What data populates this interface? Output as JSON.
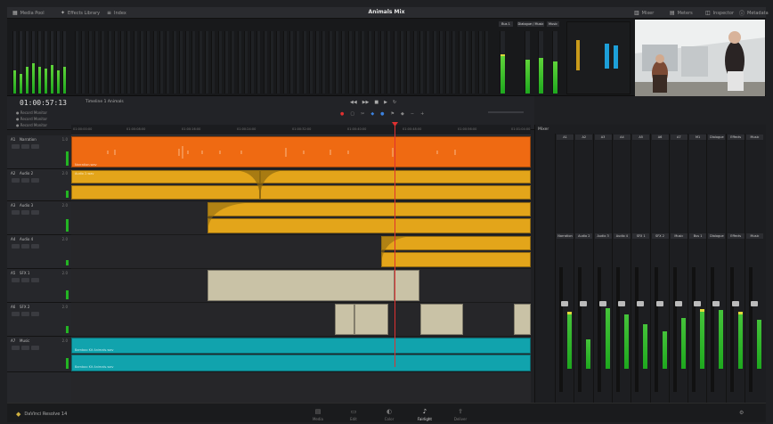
{
  "app_title": "Animals Mix",
  "topbar": {
    "left": [
      {
        "icon": "media-pool-icon",
        "label": "Media Pool"
      },
      {
        "icon": "effects-library-icon",
        "label": "Effects Library"
      },
      {
        "icon": "index-icon",
        "label": "Index"
      }
    ],
    "right": [
      {
        "icon": "mixer-icon",
        "label": "Mixer"
      },
      {
        "icon": "meters-icon",
        "label": "Meters"
      },
      {
        "icon": "inspector-icon",
        "label": "Inspector"
      },
      {
        "icon": "metadata-icon",
        "label": "Metadata"
      }
    ]
  },
  "meter_bridge": {
    "bus_labels": [
      "Bus 1",
      "Dialogue / Music",
      "Music"
    ]
  },
  "timeline": {
    "timecode": "01:00:57:13",
    "name": "Timeline 1 Animals",
    "rows": [
      "Record Monitor",
      "Record Monitor",
      "Record Monitor"
    ],
    "ruler_ticks": [
      "01:00:00:00",
      "01:00:08:00",
      "01:00:16:00",
      "01:00:24:00",
      "01:00:32:00",
      "01:00:40:00",
      "01:00:48:00",
      "01:00:56:00",
      "01:01:04:00"
    ]
  },
  "tracks": [
    {
      "id": "A1",
      "name": "Narration",
      "num": "1.0"
    },
    {
      "id": "A2",
      "name": "Audio 2",
      "num": "2.0"
    },
    {
      "id": "A3",
      "name": "Audio 3",
      "num": "2.0"
    },
    {
      "id": "A4",
      "name": "Audio 4",
      "num": "2.0"
    },
    {
      "id": "A5",
      "name": "SFX 1",
      "num": "2.0"
    },
    {
      "id": "A6",
      "name": "SFX 2",
      "num": "2.0"
    },
    {
      "id": "A7",
      "name": "Music",
      "num": "2.0"
    }
  ],
  "clips": {
    "narration": "Narration.wav",
    "audio2": "Audio 2.wav",
    "music_1": "Bamboo Kit Animals.wav",
    "music_2": "Bamboo Kit Animals.wav"
  },
  "mixer": {
    "title": "Mixer",
    "channels": [
      "A1",
      "A2",
      "A3",
      "A4",
      "A5",
      "A6",
      "A7",
      "M1",
      "Dialogue",
      "Effects",
      "Music"
    ],
    "channel_names": [
      "Narration",
      "Audio 2",
      "Audio 3",
      "Audio 4",
      "SFX 1",
      "SFX 2",
      "Music",
      "Bus 1",
      "Dialogue",
      "Effects",
      "Music"
    ],
    "levels": [
      0.55,
      0.3,
      0.62,
      0.55,
      0.45,
      0.38,
      0.52,
      0.58,
      0.6,
      0.55,
      0.5
    ],
    "peaks": [
      true,
      false,
      false,
      false,
      false,
      false,
      false,
      true,
      false,
      true,
      false
    ]
  },
  "bottombar": {
    "brand": "DaVinci Resolve 14",
    "pages": [
      {
        "icon": "media-page-icon",
        "label": "Media"
      },
      {
        "icon": "edit-page-icon",
        "label": "Edit"
      },
      {
        "icon": "color-page-icon",
        "label": "Color"
      },
      {
        "icon": "fairlight-page-icon",
        "label": "Fairlight"
      },
      {
        "icon": "deliver-page-icon",
        "label": "Deliver"
      }
    ],
    "active_page": "Fairlight"
  },
  "colors": {
    "narration": "#ef6a12",
    "dialogue": "#e3a51a",
    "sfx": "#c9c2a6",
    "music": "#11a3ad",
    "playhead": "#e03030"
  }
}
